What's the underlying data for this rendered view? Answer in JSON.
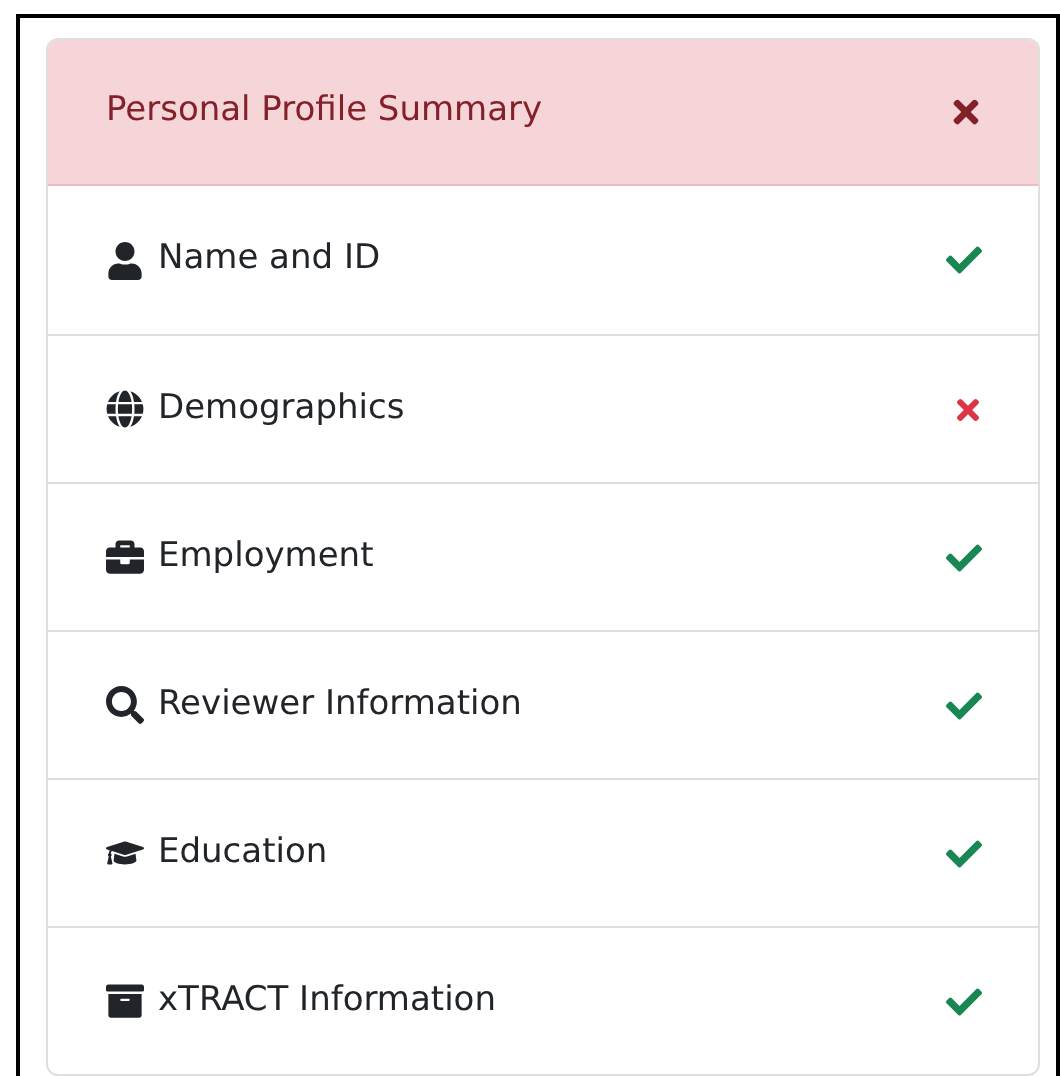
{
  "summary": {
    "title": "Personal Profile Summary",
    "complete": false
  },
  "sections": [
    {
      "label": "Name and ID",
      "complete": true
    },
    {
      "label": "Demographics",
      "complete": false
    },
    {
      "label": "Employment",
      "complete": true
    },
    {
      "label": "Reviewer Information",
      "complete": true
    },
    {
      "label": "Education",
      "complete": true
    },
    {
      "label": "xTRACT Information",
      "complete": true
    }
  ]
}
